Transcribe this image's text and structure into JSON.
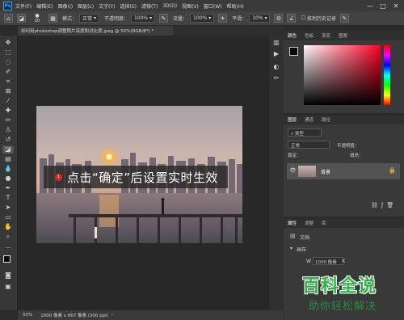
{
  "menubar": {
    "logo": "Ps",
    "items": [
      "文件(F)",
      "编辑(E)",
      "图像(I)",
      "图层(L)",
      "文字(Y)",
      "选择(S)",
      "滤镜(T)",
      "3D(D)",
      "视图(V)",
      "窗口(W)",
      "帮助(H)"
    ],
    "window_controls": [
      "—",
      "□",
      "✕"
    ]
  },
  "options": {
    "brush_size": "20",
    "mode_label": "模式：",
    "mode_value": "正常",
    "opacity_label": "不透明度：",
    "opacity_value": "100%",
    "flow_label": "流量：",
    "flow_value": "100%",
    "smooth_label": "平滑：",
    "smooth_value": "10%",
    "history_label": "抹到历史记录"
  },
  "document": {
    "tab_title": "如何用photoshop调整照片亮度和对比度.jpeg @ 50%(RGB/8*) *"
  },
  "status": {
    "zoom": "50%",
    "doc_info": "1000 像素 x 667 像素 (300 ppi)"
  },
  "panels": {
    "color_tabs": [
      "颜色",
      "色板",
      "渐变",
      "图案"
    ],
    "layers_tabs": [
      "图层",
      "通道",
      "路径"
    ],
    "layer_kind": "类型",
    "blend_mode": "正常",
    "opacity_label": "不透明度：",
    "lock_label": "锁定：",
    "fill_label": "填充：",
    "layer_name": "背景",
    "props_tabs": [
      "属性",
      "调整",
      "库"
    ],
    "props_doc": "文档",
    "props_canvas": "画布",
    "width_label": "W",
    "width_value": "1000 像素",
    "x_label": "X"
  },
  "caption": {
    "number": "1",
    "text": "点击“确定”后设置实时生效"
  },
  "watermark": {
    "main": "百科全说",
    "sub": "助你轻松解决"
  },
  "colors": {
    "foreground": "#0a0a0a",
    "background": "#ffffff",
    "accent_green": "#2bb344",
    "badge_red": "#d9251b"
  }
}
